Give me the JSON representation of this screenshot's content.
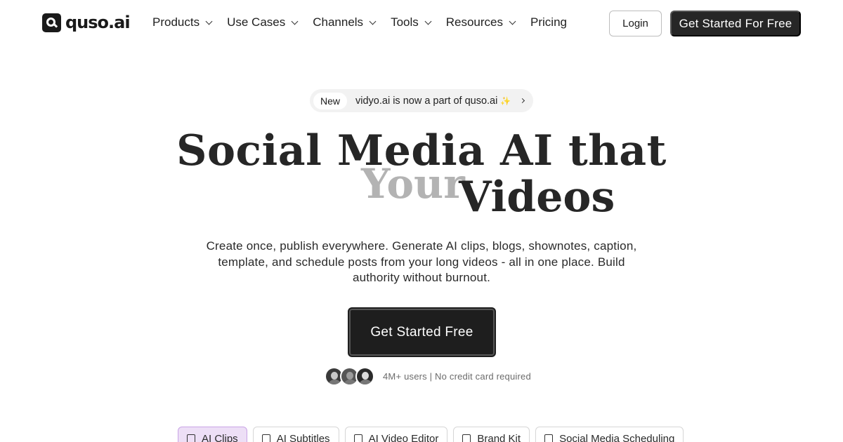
{
  "brand": {
    "name": "quso.ai"
  },
  "nav": {
    "items": [
      {
        "label": "Products",
        "dropdown": true
      },
      {
        "label": "Use Cases",
        "dropdown": true
      },
      {
        "label": "Channels",
        "dropdown": true
      },
      {
        "label": "Tools",
        "dropdown": true
      },
      {
        "label": "Resources",
        "dropdown": true
      },
      {
        "label": "Pricing",
        "dropdown": false
      }
    ],
    "login_label": "Login",
    "cta_label": "Get Started For Free"
  },
  "announcement": {
    "tag": "New",
    "text": "vidyo.ai is now a part of quso.ai",
    "sparkle": "✨"
  },
  "hero": {
    "line1": "Social Media AI that",
    "rotating_word": "Your",
    "line2_end": "Videos",
    "subtitle": "Create once, publish everywhere. Generate AI clips, blogs, shownotes, caption, template, and schedule posts from your long videos - all in one place. Build authority without burnout.",
    "cta_label": "Get Started Free",
    "social_proof": "4M+ users | No credit card required"
  },
  "tabs": [
    {
      "label": "AI Clips",
      "active": true
    },
    {
      "label": "AI Subtitles",
      "active": false
    },
    {
      "label": "AI Video Editor",
      "active": false
    },
    {
      "label": "Brand Kit",
      "active": false
    },
    {
      "label": "Social Media Scheduling",
      "active": false
    }
  ],
  "colors": {
    "primary_dark": "#262626",
    "rotating_word": "#b3b3b3",
    "active_tab_bg": "#eddff6",
    "active_tab_border": "#c9a4e6"
  }
}
